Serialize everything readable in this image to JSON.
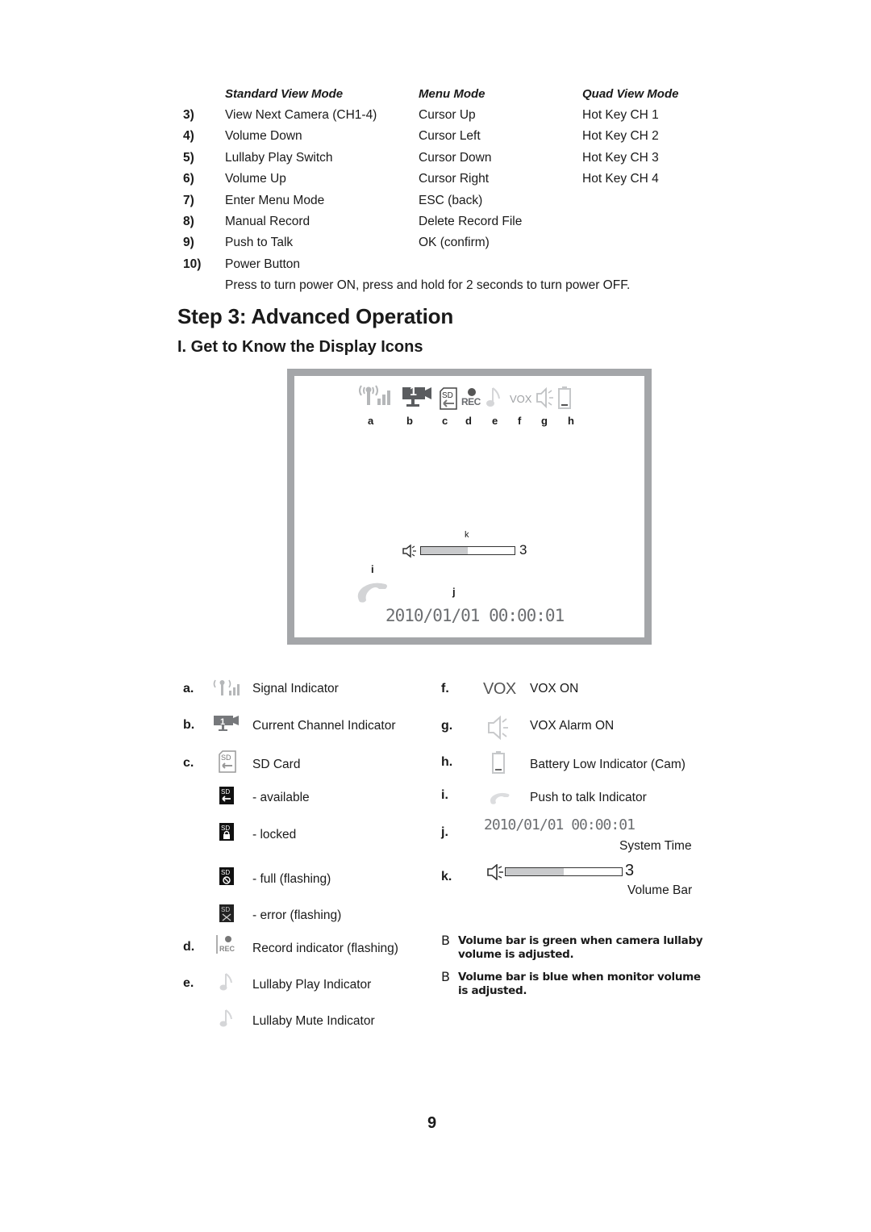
{
  "button_table": {
    "headers": [
      "Standard View Mode",
      "Menu Mode",
      "Quad View Mode"
    ],
    "rows": [
      {
        "num": "3)",
        "standard": "View Next Camera (CH1-4)",
        "menu": "Cursor Up",
        "quad": "Hot Key CH 1"
      },
      {
        "num": "4)",
        "standard": "Volume Down",
        "menu": "Cursor Left",
        "quad": "Hot Key CH 2"
      },
      {
        "num": "5)",
        "standard": "Lullaby Play Switch",
        "menu": "Cursor Down",
        "quad": "Hot Key CH 3"
      },
      {
        "num": "6)",
        "standard": "Volume Up",
        "menu": "Cursor Right",
        "quad": "Hot Key CH 4"
      },
      {
        "num": "7)",
        "standard": "Enter Menu Mode",
        "menu": "ESC (back)",
        "quad": ""
      },
      {
        "num": "8)",
        "standard": "Manual Record",
        "menu": "Delete Record File",
        "quad": ""
      },
      {
        "num": "9)",
        "standard": "Push to Talk",
        "menu": "OK (confirm)",
        "quad": ""
      },
      {
        "num": "10)",
        "standard": "Power Button",
        "menu": "",
        "quad": ""
      }
    ],
    "power_note": "Press to turn power ON, press and hold for 2 seconds to turn power OFF."
  },
  "section": {
    "title": "Step 3: Advanced Operation",
    "subtitle": "I. Get to Know the Display Icons"
  },
  "display": {
    "icon_labels": [
      "a",
      "b",
      "c",
      "d",
      "e",
      "f",
      "g",
      "h"
    ],
    "channel": "1",
    "sd_text": "SD",
    "rec_text": "REC",
    "vox_text": "VOX",
    "label_k": "k",
    "label_i": "i",
    "label_j": "j",
    "volume_level": "3",
    "volume_fill_fraction": 0.5,
    "system_time": "2010/01/01 00:00:01",
    "frame_color": "#a4a6a9"
  },
  "legend_left": [
    {
      "letter": "a.",
      "icon": "signal-icon",
      "text": "Signal Indicator"
    },
    {
      "letter": "b.",
      "icon": "camera-channel-icon",
      "text": "Current Channel Indicator"
    },
    {
      "letter": "c.",
      "icon": "sd-card-icon",
      "text": "SD Card"
    },
    {
      "letter": "",
      "icon": "sd-available-icon",
      "text": "- available"
    },
    {
      "letter": "",
      "icon": "sd-locked-icon",
      "text": "- locked"
    },
    {
      "letter": "",
      "icon": "sd-full-icon",
      "text": "- full (flashing)"
    },
    {
      "letter": "",
      "icon": "sd-error-icon",
      "text": "- error (flashing)"
    },
    {
      "letter": "d.",
      "icon": "record-icon",
      "text": "Record indicator (flashing)"
    },
    {
      "letter": "e.",
      "icon": "lullaby-play-icon",
      "text": "Lullaby Play Indicator"
    },
    {
      "letter": "",
      "icon": "lullaby-mute-icon",
      "text": "Lullaby Mute Indicator"
    }
  ],
  "legend_right": [
    {
      "letter": "f.",
      "icon": "vox-icon",
      "text": "VOX ON"
    },
    {
      "letter": "g.",
      "icon": "vox-alarm-icon",
      "text": "VOX Alarm ON"
    },
    {
      "letter": "h.",
      "icon": "battery-low-icon",
      "text": "Battery Low Indicator (Cam)"
    },
    {
      "letter": "i.",
      "icon": "push-to-talk-icon",
      "text": "Push to talk Indicator"
    },
    {
      "letter": "j.",
      "icon": "system-time",
      "text": "System Time"
    },
    {
      "letter": "k.",
      "icon": "volume-bar",
      "text": "Volume Bar"
    }
  ],
  "notes": [
    {
      "bullet": "B",
      "text_line1": "Volume bar is green when camera lullaby",
      "text_line2": "volume is adjusted."
    },
    {
      "bullet": "B",
      "text_line1": "Volume bar is blue when monitor volume",
      "text_line2": "is adjusted."
    }
  ],
  "page_number": "9"
}
